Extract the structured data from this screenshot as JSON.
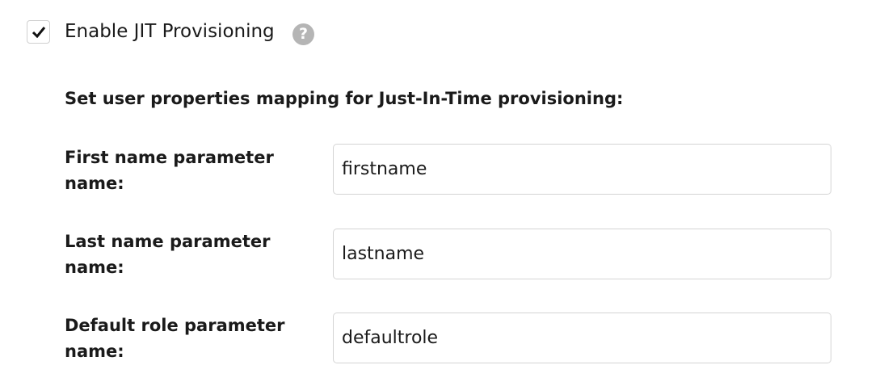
{
  "jit": {
    "label": "Enable JIT Provisioning",
    "checked": true,
    "help_icon": "question-circle-icon"
  },
  "heading": "Set user properties mapping for Just-In-Time provisioning:",
  "fields": [
    {
      "label": "First name parameter name:",
      "value": "firstname"
    },
    {
      "label": "Last name parameter name:",
      "value": "lastname"
    },
    {
      "label": "Default role parameter name:",
      "value": "defaultrole"
    }
  ]
}
